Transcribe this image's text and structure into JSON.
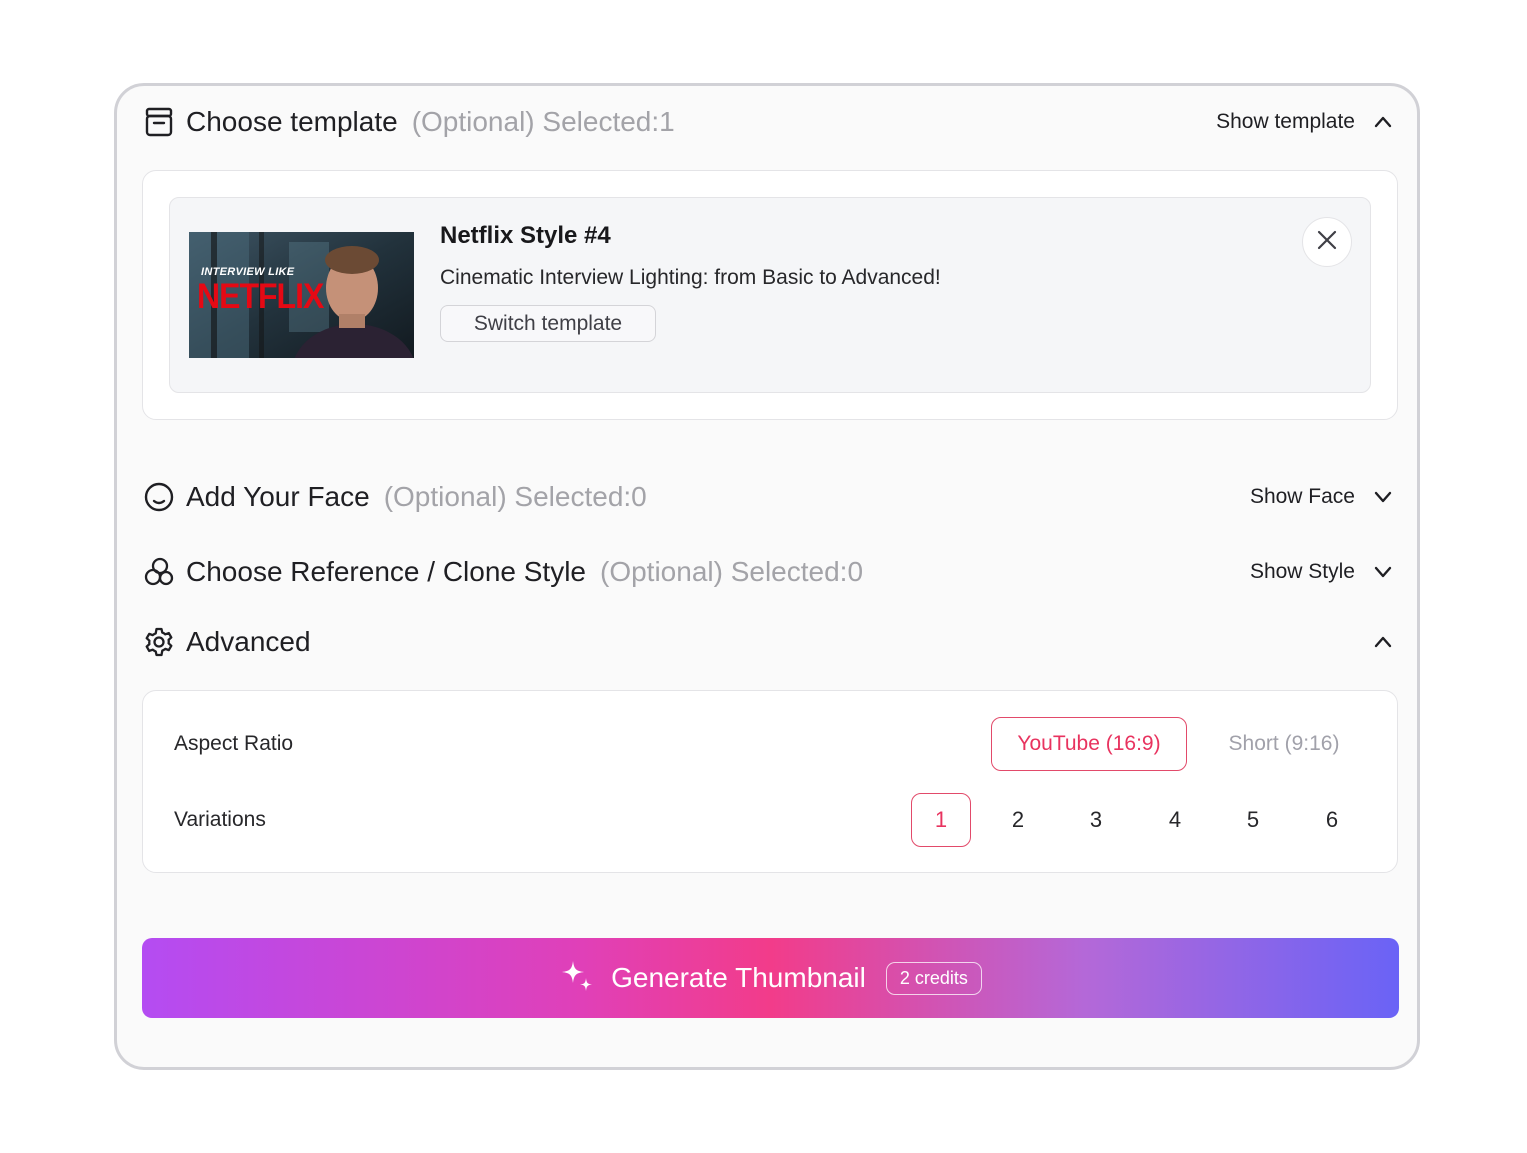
{
  "template_section": {
    "title": "Choose template",
    "meta": "(Optional) Selected:1",
    "toggle_label": "Show template",
    "selected": {
      "thumbnail_text_top": "INTERVIEW LIKE",
      "thumbnail_text_brand": "NETFLIX",
      "name": "Netflix Style #4",
      "description": "Cinematic Interview Lighting: from Basic to Advanced!",
      "switch_label": "Switch template"
    }
  },
  "face_section": {
    "title": "Add Your Face",
    "meta": "(Optional) Selected:0",
    "toggle_label": "Show Face"
  },
  "style_section": {
    "title": "Choose Reference / Clone Style",
    "meta": "(Optional) Selected:0",
    "toggle_label": "Show Style"
  },
  "advanced_section": {
    "title": "Advanced",
    "aspect_ratio": {
      "label": "Aspect Ratio",
      "options": [
        "YouTube (16:9)",
        "Short (9:16)"
      ],
      "selected": "YouTube (16:9)"
    },
    "variations": {
      "label": "Variations",
      "options": [
        "1",
        "2",
        "3",
        "4",
        "5",
        "6"
      ],
      "selected": "1"
    }
  },
  "generate": {
    "label": "Generate Thumbnail",
    "credits": "2 credits"
  },
  "colors": {
    "accent": "#e8335f",
    "gradient_start": "#b44cf2",
    "gradient_mid": "#f23c8a",
    "gradient_end": "#6a63f6"
  },
  "icons": {
    "template": "archive-box-icon",
    "face": "face-icon",
    "style": "overlapping-circles-icon",
    "advanced": "gear-icon",
    "close": "close-icon",
    "generate": "sparkles-icon"
  }
}
